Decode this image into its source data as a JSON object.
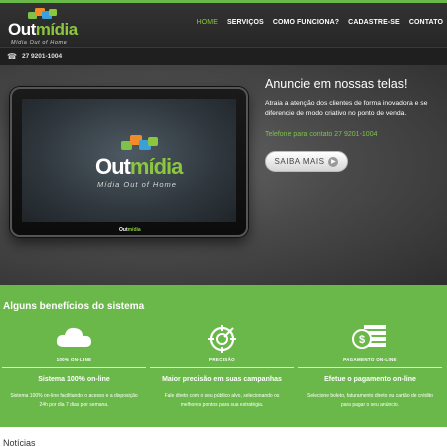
{
  "brand": {
    "name_part1": "Out",
    "name_part2": "mídia",
    "tagline": "Mídia Out of Home"
  },
  "nav": {
    "items": [
      {
        "label": "HOME",
        "active": true
      },
      {
        "label": "SERVIÇOS",
        "active": false
      },
      {
        "label": "COMO FUNCIONA?",
        "active": false
      },
      {
        "label": "CADASTRE-SE",
        "active": false
      },
      {
        "label": "CONTATO",
        "active": false
      }
    ]
  },
  "topbar": {
    "phone": "27 9201-1004"
  },
  "hero": {
    "title": "Anuncie em nossas telas!",
    "text": "Atraia a atenção dos clientes de forma inovadora e se diferencie de modo criativo no ponto de venda.",
    "phone_text": "Telefone para contato 27 9201-1004",
    "button_label": "SAIBA MAIS"
  },
  "benefits": {
    "title": "Alguns benefícios do sistema",
    "items": [
      {
        "icon": "cloud-icon",
        "caption": "100% ON-LINE",
        "title": "Sistema 100% on-line",
        "desc": "Sistema 100% on-line facilitando o acesso e a disposição 24h por dia 7 dias por semana."
      },
      {
        "icon": "target-icon",
        "caption": "PRECISÃO",
        "title": "Maior precisão em suas campanhas",
        "desc": "Fale direto com o seu público alvo, selecionando os melhores pontos para sua estratégia."
      },
      {
        "icon": "money-stack-icon",
        "caption": "PAGAMENTO ON-LINE",
        "title": "Efetue o pagamento on-line",
        "desc": "Selecione boleto, faturamento direto ou cartão de crédito para pagar o seu anúncio."
      }
    ]
  },
  "news": {
    "title": "Notícias"
  },
  "colors": {
    "accent_green": "#6bb84a",
    "logo_green": "#8cc63f",
    "header_dark": "#2b2b2b"
  }
}
